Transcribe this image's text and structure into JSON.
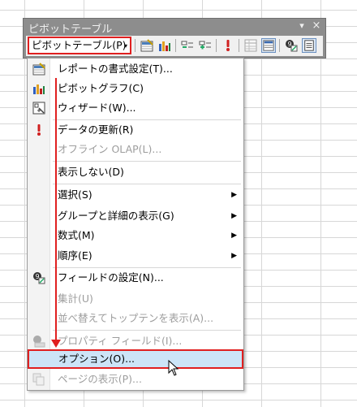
{
  "toolbar": {
    "title": "ピボットテーブル",
    "menu_button_label": "ピボットテーブル(P)",
    "dropdown_arrow": "▾",
    "close_glyph": "×",
    "options_glyph": "▾",
    "icons": [
      "format-report-icon",
      "chart-wizard-icon",
      "hide-detail-icon",
      "show-detail-icon",
      "refresh-icon",
      "always-display-items-icon",
      "include-hidden-items-icon",
      "field-settings-icon",
      "hide-field-list-icon"
    ]
  },
  "menu": {
    "items": [
      {
        "label": "レポートの書式設定(T)...",
        "icon": "format-report-icon",
        "disabled": false
      },
      {
        "label": "ピボットグラフ(C)",
        "icon": "chart-wizard-icon",
        "disabled": false
      },
      {
        "label": "ウィザード(W)...",
        "icon": "wizard-icon",
        "disabled": false
      },
      {
        "label": "データの更新(R)",
        "icon": "refresh-icon",
        "disabled": false
      },
      {
        "label": "オフライン OLAP(L)...",
        "icon": "",
        "disabled": true
      },
      {
        "label": "表示しない(D)",
        "icon": "",
        "disabled": false
      },
      {
        "label": "選択(S)",
        "icon": "",
        "disabled": false,
        "submenu": true
      },
      {
        "label": "グループと詳細の表示(G)",
        "icon": "",
        "disabled": false,
        "submenu": true
      },
      {
        "label": "数式(M)",
        "icon": "",
        "disabled": false,
        "submenu": true
      },
      {
        "label": "順序(E)",
        "icon": "",
        "disabled": false,
        "submenu": true
      },
      {
        "label": "フィールドの設定(N)...",
        "icon": "field-settings-icon",
        "disabled": false
      },
      {
        "label": "集計(U)",
        "icon": "",
        "disabled": true
      },
      {
        "label": "並べ替えてトップテンを表示(A)...",
        "icon": "",
        "disabled": true
      },
      {
        "label": "プロパティ フィールド(I)...",
        "icon": "property-fields-icon",
        "disabled": true
      },
      {
        "label": "オプション(O)...",
        "icon": "",
        "disabled": false,
        "highlighted": true
      },
      {
        "label": "ページの表示(P)...",
        "icon": "show-pages-icon",
        "disabled": true
      }
    ],
    "submenu_arrow": "▶"
  },
  "colors": {
    "accent_red": "#e02020",
    "highlight": "#cce4f7",
    "disabled_text": "#9d9d9d",
    "toolbar_frame": "#8d8d8d"
  }
}
